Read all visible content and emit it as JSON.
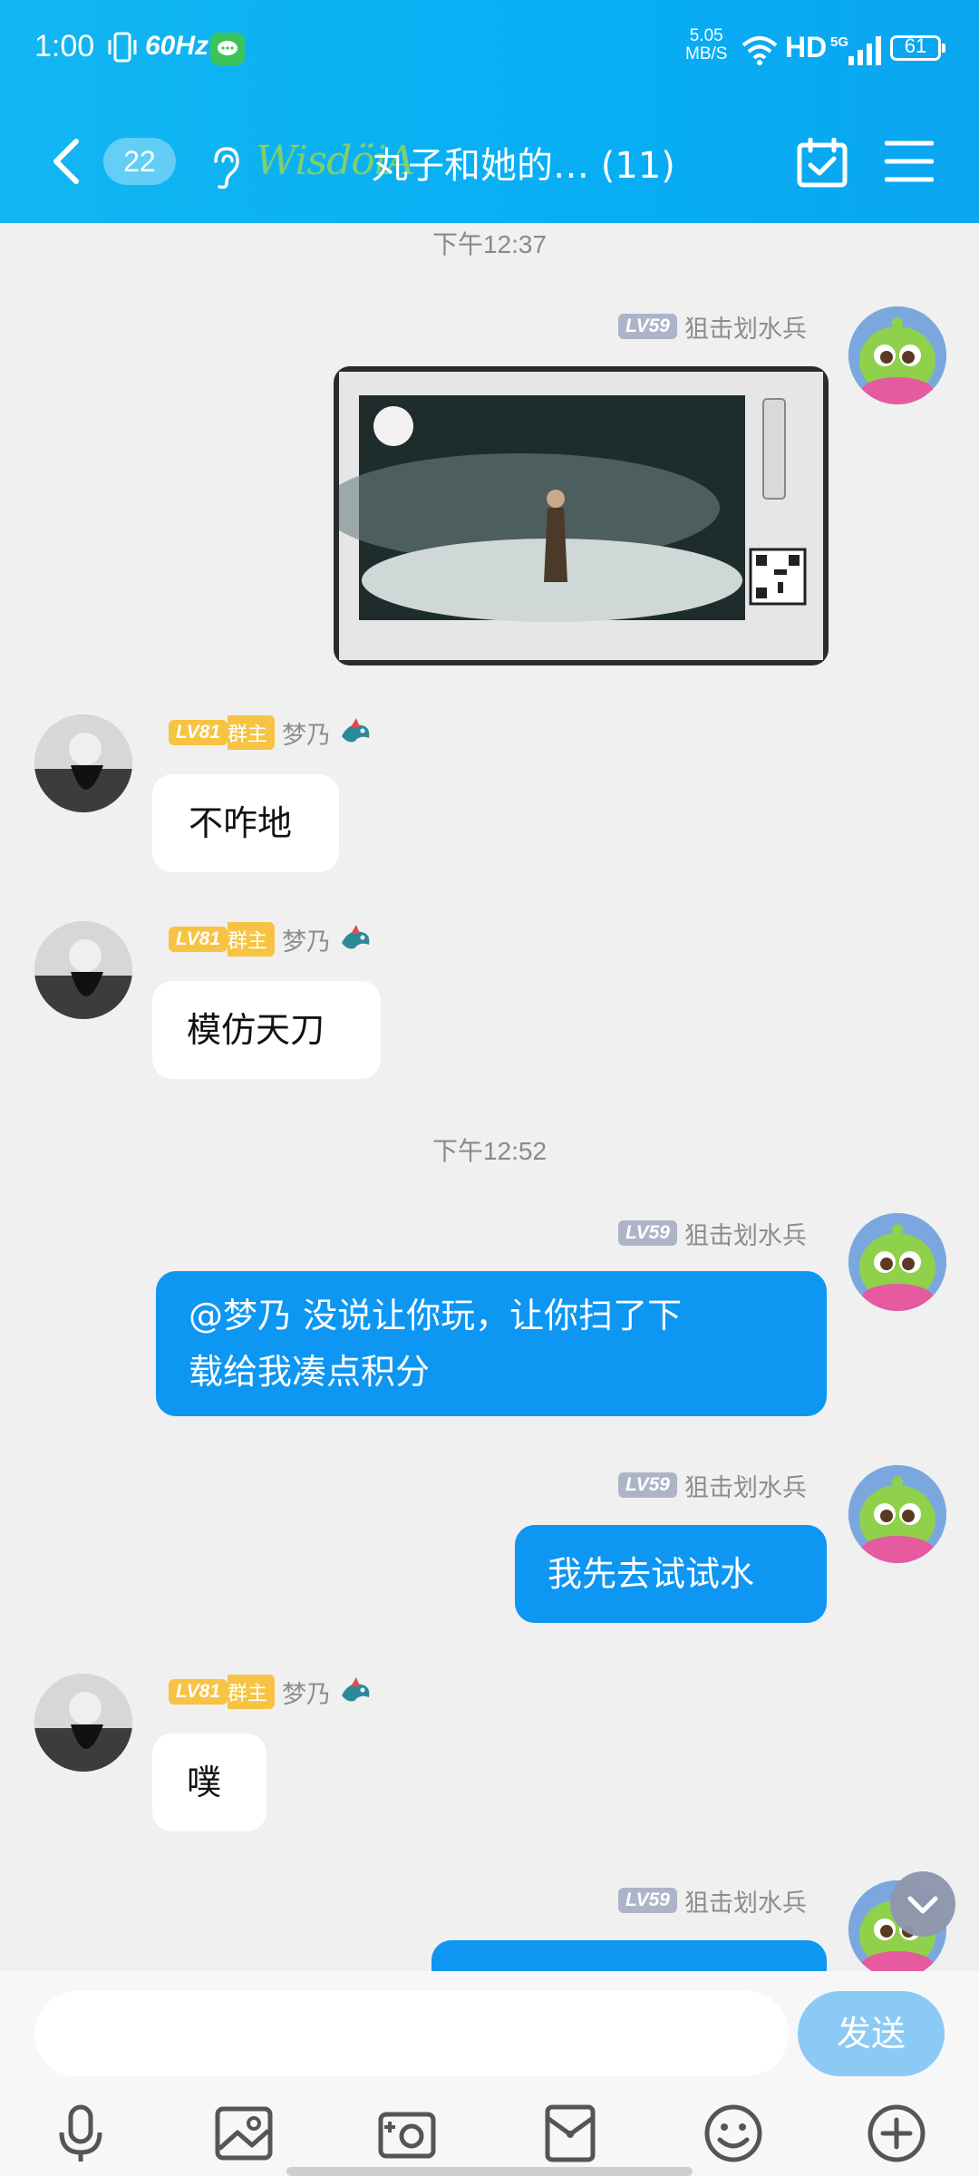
{
  "status_bar": {
    "time": "1:00",
    "refresh_rate": "60Hz",
    "net_speed_value": "5.05",
    "net_speed_unit": "MB/S",
    "hd": "HD",
    "network": "5G",
    "battery": "61"
  },
  "header": {
    "unread_count": "22",
    "group_logo": "WisdöiA",
    "title": "丸子和她的… (11)"
  },
  "messages": [
    {
      "type": "timestamp",
      "text": "下午12:37"
    },
    {
      "type": "image",
      "side": "right",
      "level": "LV59",
      "sender": "狙击划水兵"
    },
    {
      "type": "text",
      "side": "left",
      "level": "LV81",
      "role": "群主",
      "sender": "梦乃",
      "text": "不咋地"
    },
    {
      "type": "text",
      "side": "left",
      "level": "LV81",
      "role": "群主",
      "sender": "梦乃",
      "text": "模仿天刀"
    },
    {
      "type": "timestamp",
      "text": "下午12:52"
    },
    {
      "type": "text",
      "side": "right",
      "level": "LV59",
      "sender": "狙击划水兵",
      "line1": "@梦乃 没说让你玩，让你扫了下",
      "line2": "载给我凑点积分"
    },
    {
      "type": "text",
      "side": "right",
      "level": "LV59",
      "sender": "狙击划水兵",
      "text": "我先去试试水"
    },
    {
      "type": "text",
      "side": "left",
      "level": "LV81",
      "role": "群主",
      "sender": "梦乃",
      "text": "噗"
    },
    {
      "type": "text",
      "side": "right",
      "level": "LV59",
      "sender": "狙击划水兵",
      "text": ""
    }
  ],
  "input": {
    "placeholder": "",
    "send_label": "发送"
  },
  "toolbar": [
    "microphone-icon",
    "image-icon",
    "camera-icon",
    "red-packet-icon",
    "emoji-icon",
    "plus-icon"
  ],
  "colors": {
    "header": "#0aaef3",
    "outgoing_bubble": "#0d96f2",
    "incoming_bubble": "#ffffff",
    "level_grey": "#aeb4c8",
    "level_gold": "#f7c342",
    "send_button": "#8ccaf6"
  }
}
